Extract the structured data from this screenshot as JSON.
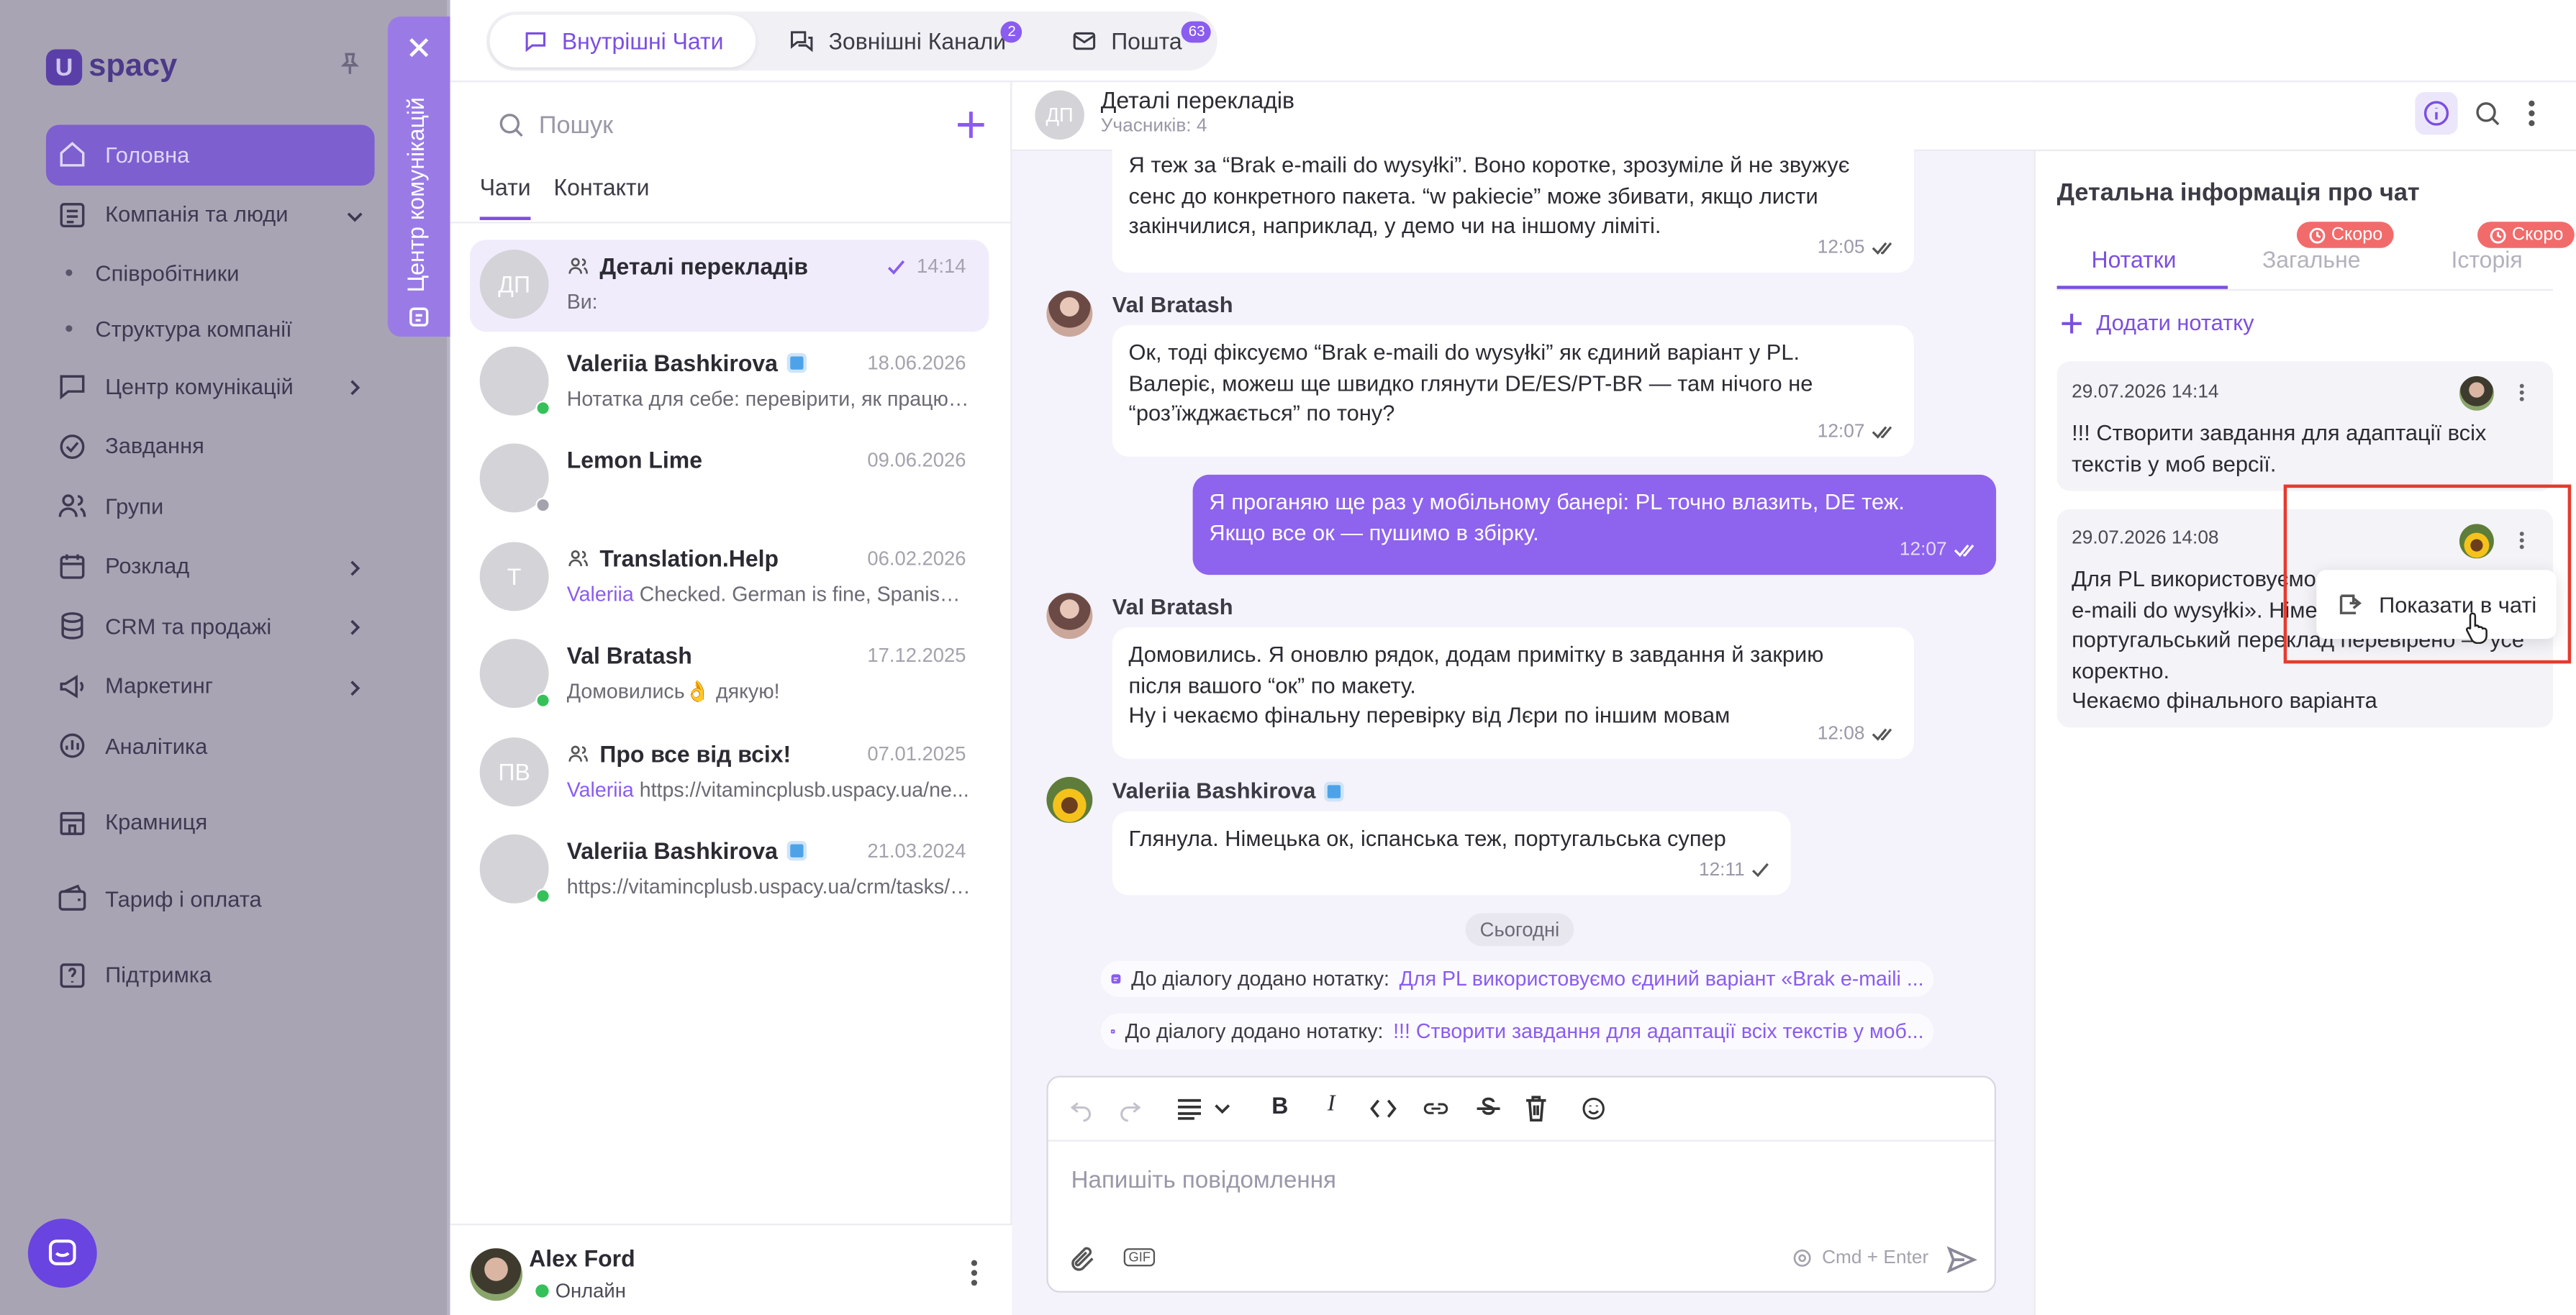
{
  "app": {
    "logo": "spacy",
    "logo_mark": "U"
  },
  "nav": {
    "items": [
      {
        "label": "Головна",
        "icon": "home-icon",
        "active": true
      },
      {
        "label": "Компанія та люди",
        "icon": "building-icon",
        "chevron": "down"
      },
      {
        "label": "Співробітники",
        "sub": true
      },
      {
        "label": "Структура компанії",
        "sub": true
      },
      {
        "label": "Центр комунікацій",
        "icon": "chat-icon",
        "chevron": "right"
      },
      {
        "label": "Завдання",
        "icon": "task-icon"
      },
      {
        "label": "Групи",
        "icon": "group-icon"
      },
      {
        "label": "Розклад",
        "icon": "calendar-icon",
        "chevron": "right"
      },
      {
        "label": "CRM та продажі",
        "icon": "database-icon",
        "chevron": "right"
      },
      {
        "label": "Маркетинг",
        "icon": "megaphone-icon",
        "chevron": "right"
      },
      {
        "label": "Аналітика",
        "icon": "chart-icon"
      },
      {
        "label": "Крамниця",
        "icon": "store-icon",
        "gap": true
      },
      {
        "label": "Тариф і оплата",
        "icon": "wallet-icon",
        "gap": true
      },
      {
        "label": "Підтримка",
        "icon": "help-icon",
        "gap": true
      }
    ]
  },
  "comm_center": {
    "label": "Центр комунікацій"
  },
  "top_tabs": [
    {
      "label": "Внутрішні Чати",
      "active": true
    },
    {
      "label": "Зовнішні Канали",
      "badge": "2"
    },
    {
      "label": "Пошта",
      "badge": "63"
    }
  ],
  "search": {
    "placeholder": "Пошук"
  },
  "list_tabs": {
    "chats": "Чати",
    "contacts": "Контакти"
  },
  "chats": [
    {
      "initials": "ДП",
      "name": "Деталі перекладів",
      "time": "14:14",
      "preview_prefix": "",
      "preview": "Ви:",
      "group": true,
      "active": true,
      "read": true
    },
    {
      "avatar": "flower",
      "name": "Valeriia Bashkirova",
      "verified": true,
      "time": "18.06.2026",
      "preview_prefix": "",
      "preview": "Нотатка для себе: перевірити, як працюють...",
      "status": "#36c05a"
    },
    {
      "avatar": "lemon",
      "name": "Lemon Lime",
      "time": "09.06.2026",
      "preview_prefix": "",
      "preview": "",
      "status": "#a4a3ad"
    },
    {
      "initials": "T",
      "name": "Translation.Help",
      "group": true,
      "time": "06.02.2026",
      "preview_prefix": "Valeriia",
      "preview": " Checked. German is fine, Spanish to..."
    },
    {
      "avatar": "photo1",
      "name": "Val Bratash",
      "time": "17.12.2025",
      "preview_prefix": "",
      "preview": "Домовились👌 дякую!",
      "status": "#36c05a"
    },
    {
      "initials": "ПВ",
      "name": "Про все від всіх!",
      "group": true,
      "time": "07.01.2025",
      "preview_prefix": "Valeriia",
      "preview": " https://vitamincplusb.uspacy.ua/ne..."
    },
    {
      "avatar": "flower",
      "name": "Valeriia Bashkirova",
      "verified": true,
      "time": "21.03.2024",
      "preview_prefix": "",
      "preview": "https://vitamincplusb.uspacy.ua/crm/tasks/t...",
      "status": "#36c05a"
    }
  ],
  "me": {
    "name": "Alex Ford",
    "status": "Онлайн"
  },
  "chat": {
    "initials": "ДП",
    "title": "Деталі перекладів",
    "participants": "Учасників: 4"
  },
  "messages": {
    "m1": {
      "lines": [
        "Я теж за “Brak e-maili do wysyłki”. Воно коротке, зрозуміле й не звужує",
        "сенс до конкретного пакета. “w pakiecie” може збивати, якщо листи",
        "закінчилися, наприклад, у демо чи на іншому ліміті."
      ],
      "time": "12:05"
    },
    "m2": {
      "sender": "Val Bratash",
      "lines": [
        "Ок, тоді фіксуємо “Brak e-maili do wysyłki” як єдиний варіант у PL.",
        "Валеріє, можеш ще швидко глянути DE/ES/PT-BR — там нічого не",
        "“роз’їжджається” по тону?"
      ],
      "time": "12:07"
    },
    "m3": {
      "lines": [
        "Я проганяю ще раз у мобільному банері: PL точно влазить, DE теж.",
        "Якщо все ок — пушимо в збірку."
      ],
      "time": "12:07"
    },
    "m4": {
      "sender": "Val Bratash",
      "lines": [
        "Домовились. Я оновлю рядок, додам примітку в завдання й закрию",
        "після вашого “ок” по макету.",
        "Ну і чекаємо фінальну перевірку від Лєри по іншим мовам"
      ],
      "time": "12:08"
    },
    "m5": {
      "sender": "Valeriia Bashkirova",
      "lines": [
        "Глянула. Німецька ок, іспанська теж, португальська супер"
      ],
      "time": "12:11"
    }
  },
  "today": "Сьогодні",
  "system": [
    {
      "text": "До діалогу додано нотатку:",
      "link": "Для PL використовуємо єдиний варіант «Brak e-maili ..."
    },
    {
      "text": "До діалогу додано нотатку:",
      "link": "!!! Створити завдання для адаптації всіх текстів у моб..."
    }
  ],
  "composer": {
    "placeholder": "Напишіть повідомлення",
    "hint": "Cmd + Enter"
  },
  "info": {
    "title": "Детальна інформація про чат",
    "tabs": {
      "notes": "Нотатки",
      "general": "Загальне",
      "history": "Історія",
      "soon": "Скоро"
    },
    "add_note": "Додати нотатку",
    "notes": [
      {
        "date": "29.07.2026 14:14",
        "lines": [
          "!!! Створити завдання для адаптації всіх",
          "текстів у моб версії."
        ]
      },
      {
        "date": "29.07.2026 14:08",
        "lines": [
          "Для PL використовуємо",
          "e-maili do wysyłki». Німе",
          "португальський переклад перевірено — усе",
          "коректно.",
          "Чекаємо фінального варіанта"
        ]
      }
    ],
    "menu_item": "Показати в чаті"
  },
  "colors": {
    "accent": "#7b4fe0",
    "my_bubble": "#8e63ee",
    "highlight": "#e63a2e",
    "soon": "#f26b6b"
  }
}
